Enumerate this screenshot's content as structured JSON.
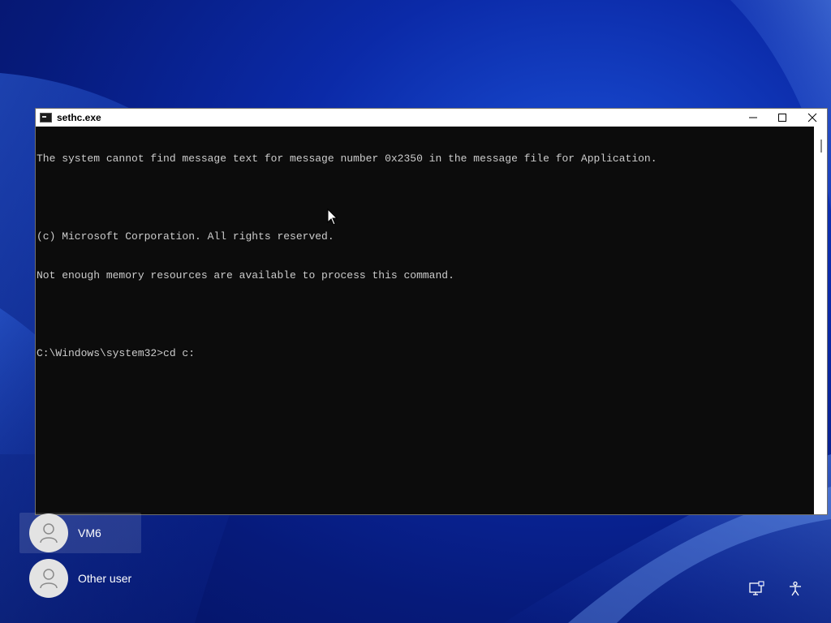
{
  "window": {
    "title": "sethc.exe",
    "icon": "console-icon",
    "controls": {
      "minimize": "minimize-icon",
      "maximize": "maximize-icon",
      "close": "close-icon"
    }
  },
  "console": {
    "lines": [
      "The system cannot find message text for message number 0x2350 in the message file for Application.",
      "",
      "(c) Microsoft Corporation. All rights reserved.",
      "Not enough memory resources are available to process this command.",
      "",
      "C:\\Windows\\system32>cd c:"
    ],
    "text_color": "#cccccc",
    "background": "#0c0c0c"
  },
  "login": {
    "users": [
      {
        "name": "VM6",
        "icon": "user-avatar-icon",
        "selected": true
      },
      {
        "name": "Other user",
        "icon": "user-avatar-icon",
        "selected": false
      }
    ],
    "bottom_icons": [
      "network-icon",
      "accessibility-icon"
    ]
  },
  "colors": {
    "wallpaper_primary": "#0b2aa8",
    "wallpaper_highlight": "#4f8fff"
  }
}
